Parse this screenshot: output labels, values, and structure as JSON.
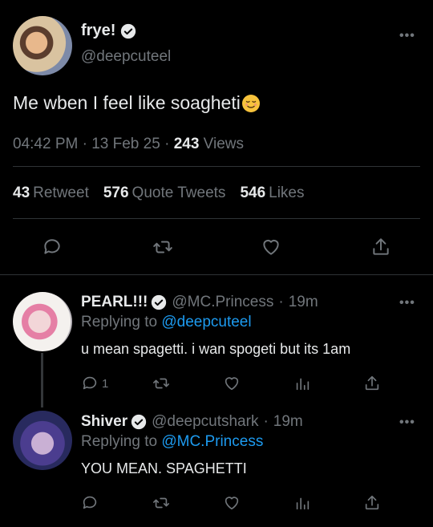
{
  "main_tweet": {
    "name": "frye!",
    "handle": "@deepcuteel",
    "text": "Me wben I feel like soagheti",
    "emoji": "relieved-face-emoji",
    "time": "04:42 PM",
    "date": "13 Feb 25",
    "views_count": "243",
    "views_label": "Views",
    "retweets_count": "43",
    "retweets_label": "Retweet",
    "quotes_count": "576",
    "quotes_label": "Quote Tweets",
    "likes_count": "546",
    "likes_label": "Likes"
  },
  "replies": [
    {
      "name": "PEARL!!!",
      "handle": "@MC.Princess",
      "time": "19m",
      "replying_prefix": "Replying to",
      "replying_to": "@deepcuteel",
      "text": "u mean spagetti. i wan spogeti but its 1am",
      "reply_count": "1"
    },
    {
      "name": "Shiver",
      "handle": "@deepcutshark",
      "time": "19m",
      "replying_prefix": "Replying to",
      "replying_to": "@MC.Princess",
      "text": "YOU MEAN. SPAGHETTI"
    }
  ],
  "ui": {
    "more_glyph": "•••",
    "separator": "·"
  },
  "colors": {
    "background": "#000000",
    "text": "#e7e9ea",
    "muted": "#71767b",
    "link": "#1d9bf0",
    "divider": "#2f3336"
  }
}
